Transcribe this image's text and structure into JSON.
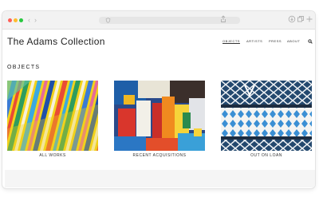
{
  "site": {
    "title": "The Adams Collection"
  },
  "nav": {
    "items": [
      "OBJECTS",
      "ARTISTS",
      "PRESS",
      "ABOUT"
    ],
    "active": "OBJECTS"
  },
  "section": {
    "title": "OBJECTS"
  },
  "cards": [
    {
      "caption": "ALL WORKS"
    },
    {
      "caption": "RECENT ACQUISITIONS"
    },
    {
      "caption": "OUT ON LOAN"
    }
  ],
  "icons": {
    "browser": [
      "back-icon",
      "forward-icon",
      "shield-icon",
      "share-icon",
      "download-icon",
      "tabs-icon",
      "plus-icon"
    ],
    "site": [
      "search-icon"
    ]
  },
  "colors": {
    "close": "#ff5f57",
    "minimize": "#febc2e",
    "zoom": "#28c840"
  }
}
